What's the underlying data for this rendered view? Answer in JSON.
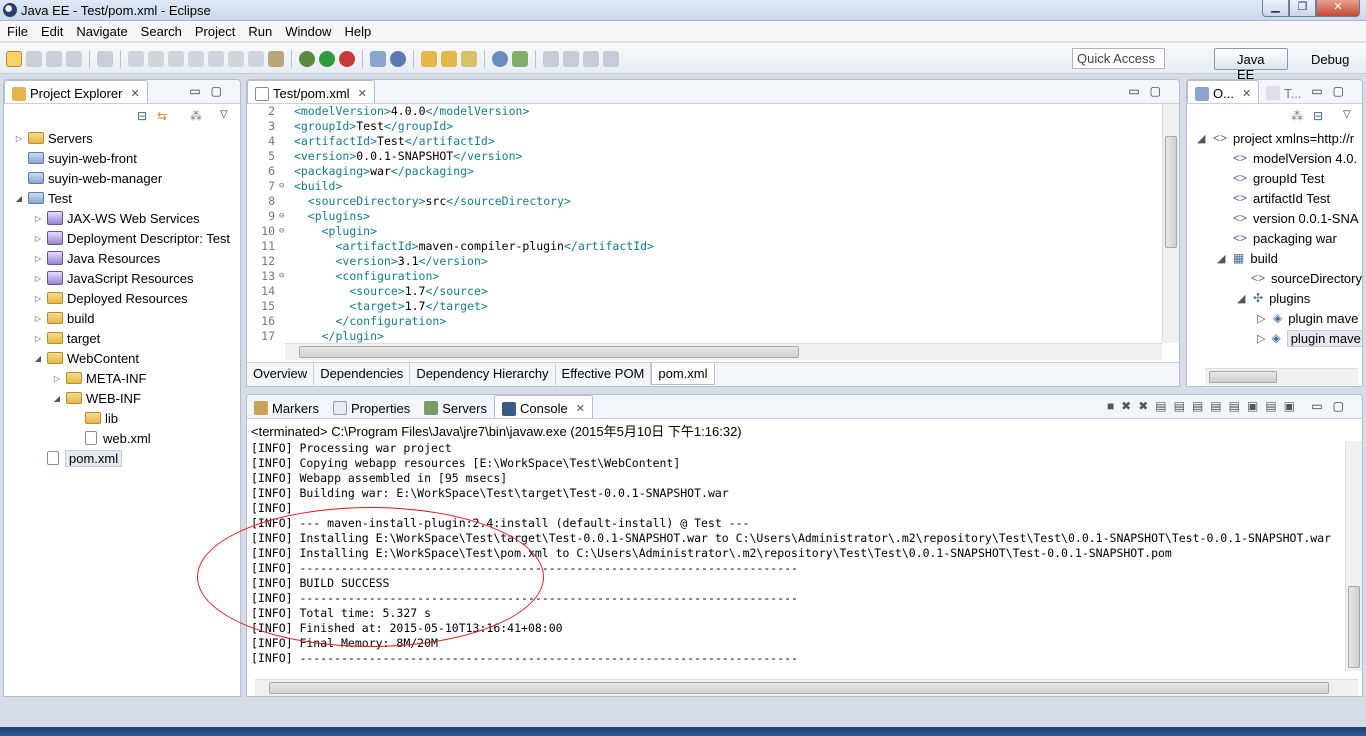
{
  "window": {
    "title": "Java EE - Test/pom.xml - Eclipse"
  },
  "menu": [
    "File",
    "Edit",
    "Navigate",
    "Search",
    "Project",
    "Run",
    "Window",
    "Help"
  ],
  "toolbar": {
    "quick_access": "Quick Access"
  },
  "perspectives": {
    "java_ee": "Java EE",
    "debug": "Debug"
  },
  "project_explorer": {
    "tab": "Project Explorer",
    "items": [
      {
        "label": "Servers",
        "depth": 0,
        "twisty": "▷",
        "icon": "folder"
      },
      {
        "label": "suyin-web-front",
        "depth": 0,
        "twisty": "",
        "icon": "proj"
      },
      {
        "label": "suyin-web-manager",
        "depth": 0,
        "twisty": "",
        "icon": "proj"
      },
      {
        "label": "Test",
        "depth": 0,
        "twisty": "◢",
        "icon": "proj"
      },
      {
        "label": "JAX-WS Web Services",
        "depth": 1,
        "twisty": "▷",
        "icon": "lib"
      },
      {
        "label": "Deployment Descriptor: Test",
        "depth": 1,
        "twisty": "▷",
        "icon": "lib"
      },
      {
        "label": "Java Resources",
        "depth": 1,
        "twisty": "▷",
        "icon": "lib"
      },
      {
        "label": "JavaScript Resources",
        "depth": 1,
        "twisty": "▷",
        "icon": "lib"
      },
      {
        "label": "Deployed Resources",
        "depth": 1,
        "twisty": "▷",
        "icon": "folder"
      },
      {
        "label": "build",
        "depth": 1,
        "twisty": "▷",
        "icon": "folder"
      },
      {
        "label": "target",
        "depth": 1,
        "twisty": "▷",
        "icon": "folder"
      },
      {
        "label": "WebContent",
        "depth": 1,
        "twisty": "◢",
        "icon": "folder"
      },
      {
        "label": "META-INF",
        "depth": 2,
        "twisty": "▷",
        "icon": "folder"
      },
      {
        "label": "WEB-INF",
        "depth": 2,
        "twisty": "◢",
        "icon": "folder"
      },
      {
        "label": "lib",
        "depth": 3,
        "twisty": "",
        "icon": "folder"
      },
      {
        "label": "web.xml",
        "depth": 3,
        "twisty": "",
        "icon": "file"
      },
      {
        "label": "pom.xml",
        "depth": 1,
        "twisty": "",
        "icon": "file",
        "selected": true
      }
    ]
  },
  "editor": {
    "tab": "Test/pom.xml",
    "lines": [
      {
        "n": "2",
        "fold": "",
        "indent": "",
        "open": "<modelVersion>",
        "text": "4.0.0",
        "close": "</modelVersion>"
      },
      {
        "n": "3",
        "fold": "",
        "indent": "",
        "open": "<groupId>",
        "text": "Test",
        "close": "</groupId>"
      },
      {
        "n": "4",
        "fold": "",
        "indent": "",
        "open": "<artifactId>",
        "text": "Test",
        "close": "</artifactId>"
      },
      {
        "n": "5",
        "fold": "",
        "indent": "",
        "open": "<version>",
        "text": "0.0.1-SNAPSHOT",
        "close": "</version>"
      },
      {
        "n": "6",
        "fold": "",
        "indent": "",
        "open": "<packaging>",
        "text": "war",
        "close": "</packaging>"
      },
      {
        "n": "7",
        "fold": "⊖",
        "indent": "",
        "open": "<build>",
        "text": "",
        "close": ""
      },
      {
        "n": "8",
        "fold": "",
        "indent": "  ",
        "open": "<sourceDirectory>",
        "text": "src",
        "close": "</sourceDirectory>"
      },
      {
        "n": "9",
        "fold": "⊖",
        "indent": "  ",
        "open": "<plugins>",
        "text": "",
        "close": ""
      },
      {
        "n": "10",
        "fold": "⊖",
        "indent": "    ",
        "open": "<plugin>",
        "text": "",
        "close": ""
      },
      {
        "n": "11",
        "fold": "",
        "indent": "      ",
        "open": "<artifactId>",
        "text": "maven-compiler-plugin",
        "close": "</artifactId>"
      },
      {
        "n": "12",
        "fold": "",
        "indent": "      ",
        "open": "<version>",
        "text": "3.1",
        "close": "</version>"
      },
      {
        "n": "13",
        "fold": "⊖",
        "indent": "      ",
        "open": "<configuration>",
        "text": "",
        "close": ""
      },
      {
        "n": "14",
        "fold": "",
        "indent": "        ",
        "open": "<source>",
        "text": "1.7",
        "close": "</source>"
      },
      {
        "n": "15",
        "fold": "",
        "indent": "        ",
        "open": "<target>",
        "text": "1.7",
        "close": "</target>"
      },
      {
        "n": "16",
        "fold": "",
        "indent": "      ",
        "open": "</configuration>",
        "text": "",
        "close": ""
      },
      {
        "n": "17",
        "fold": "",
        "indent": "    ",
        "open": "</plugin>",
        "text": "",
        "close": ""
      }
    ],
    "bottom_tabs": [
      "Overview",
      "Dependencies",
      "Dependency Hierarchy",
      "Effective POM",
      "pom.xml"
    ]
  },
  "outline": {
    "tab": "O...",
    "tab2": "T...",
    "items": [
      {
        "twisty": "◢",
        "icon": "<>",
        "label": "project xmlns=http://r",
        "depth": 0
      },
      {
        "twisty": "",
        "icon": "<>",
        "label": "modelVersion  4.0.",
        "depth": 1
      },
      {
        "twisty": "",
        "icon": "<>",
        "label": "groupId  Test",
        "depth": 1
      },
      {
        "twisty": "",
        "icon": "<>",
        "label": "artifactId  Test",
        "depth": 1
      },
      {
        "twisty": "",
        "icon": "<>",
        "label": "version  0.0.1-SNA",
        "depth": 1
      },
      {
        "twisty": "",
        "icon": "<>",
        "label": "packaging  war",
        "depth": 1
      },
      {
        "twisty": "◢",
        "icon": "▦",
        "label": "build",
        "depth": 1
      },
      {
        "twisty": "",
        "icon": "<>",
        "label": "sourceDirectory",
        "depth": 2
      },
      {
        "twisty": "◢",
        "icon": "✣",
        "label": "plugins",
        "depth": 2
      },
      {
        "twisty": "▷",
        "icon": "◈",
        "label": "plugin  mave",
        "depth": 3
      },
      {
        "twisty": "▷",
        "icon": "◈",
        "label": "plugin  mave",
        "depth": 3,
        "selected": true
      }
    ]
  },
  "console": {
    "tabs": [
      "Markers",
      "Properties",
      "Servers",
      "Console"
    ],
    "terminated": "<terminated> C:\\Program Files\\Java\\jre7\\bin\\javaw.exe (2015年5月10日 下午1:16:32)",
    "lines": [
      "[INFO] Processing war project",
      "[INFO] Copying webapp resources [E:\\WorkSpace\\Test\\WebContent]",
      "[INFO] Webapp assembled in [95 msecs]",
      "[INFO] Building war: E:\\WorkSpace\\Test\\target\\Test-0.0.1-SNAPSHOT.war",
      "[INFO]",
      "[INFO] --- maven-install-plugin:2.4:install (default-install) @ Test ---",
      "[INFO] Installing E:\\WorkSpace\\Test\\target\\Test-0.0.1-SNAPSHOT.war to C:\\Users\\Administrator\\.m2\\repository\\Test\\Test\\0.0.1-SNAPSHOT\\Test-0.0.1-SNAPSHOT.war",
      "[INFO] Installing E:\\WorkSpace\\Test\\pom.xml to C:\\Users\\Administrator\\.m2\\repository\\Test\\Test\\0.0.1-SNAPSHOT\\Test-0.0.1-SNAPSHOT.pom",
      "[INFO] ------------------------------------------------------------------------",
      "[INFO] BUILD SUCCESS",
      "[INFO] ------------------------------------------------------------------------",
      "[INFO] Total time: 5.327 s",
      "[INFO] Finished at: 2015-05-10T13:16:41+08:00",
      "[INFO] Final Memory: 8M/20M",
      "[INFO] ------------------------------------------------------------------------"
    ]
  },
  "colors": {
    "xml_tag": "#157c8c",
    "annotation": "#e02020"
  }
}
